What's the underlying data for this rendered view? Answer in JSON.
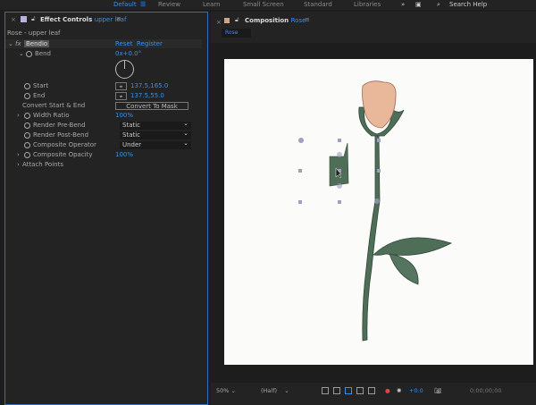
{
  "workspaces": [
    {
      "label": "Default",
      "active": true
    },
    {
      "label": "Review"
    },
    {
      "label": "Learn"
    },
    {
      "label": "Small Screen"
    },
    {
      "label": "Standard"
    },
    {
      "label": "Libraries"
    }
  ],
  "search_placeholder": "Search Help",
  "effect_panel": {
    "title": "Effect Controls",
    "layer": "upper leaf",
    "subtitle": "Rose - upper leaf",
    "effect_name": "Bendio",
    "reset": "Reset",
    "register": "Register",
    "bend_label": "Bend",
    "bend_value": "0x+0.0°",
    "start_label": "Start",
    "start_value": "137.5,165.0",
    "end_label": "End",
    "end_value": "137.5,55.0",
    "convert_label": "Convert Start & End",
    "convert_button": "Convert To Mask",
    "width_label": "Width Ratio",
    "width_value": "100%",
    "pre_label": "Render Pre-Bend",
    "pre_value": "Static",
    "post_label": "Render Post-Bend",
    "post_value": "Static",
    "op_label": "Composite Operator",
    "op_value": "Under",
    "opacity_label": "Composite Opacity",
    "opacity_value": "100%",
    "attach_label": "Attach Points"
  },
  "comp_panel": {
    "title": "Composition",
    "comp": "Rose",
    "tab": "Rose"
  },
  "viewer_bar": {
    "zoom": "50%",
    "resolution": "(Half)",
    "exposure": "+0.0",
    "timecode": "0;00;00;00"
  },
  "colors": {
    "accent": "#3d8ee6",
    "leaf": "#4f6e58",
    "petal": "#e9b79a"
  }
}
